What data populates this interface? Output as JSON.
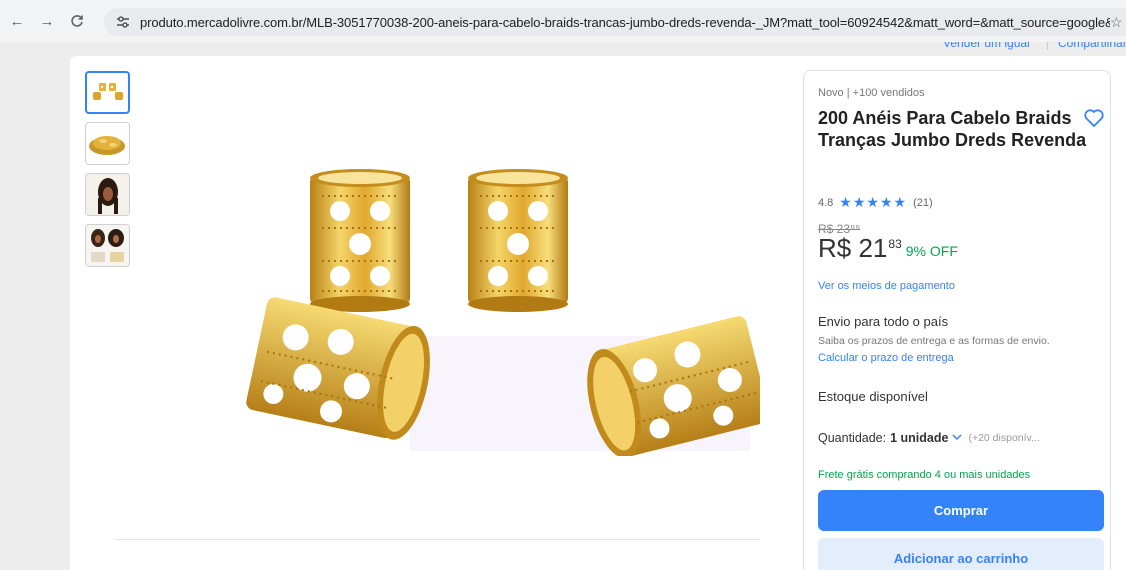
{
  "browser": {
    "url": "produto.mercadolivre.com.br/MLB-3051770038-200-aneis-para-cabelo-braids-trancas-jumbo-dreds-revenda-_JM?matt_tool=60924542&matt_word=&matt_source=google&...",
    "back_icon": "←",
    "forward_icon": "→",
    "reload_icon": "C"
  },
  "header_strip": {
    "left_link": "",
    "right_links": [
      "Vender um igual",
      "Compartilhar"
    ]
  },
  "gallery": {
    "thumbnails": [
      "rings-thumb",
      "pile-thumb",
      "braid-model-thumb",
      "collage-thumb"
    ],
    "active_index": 0
  },
  "product": {
    "condition": "Novo  |  +100 vendidos",
    "title": "200 Anéis Para Cabelo Braids Tranças Jumbo Dreds Revenda",
    "rating": "4.8",
    "stars": "★★★★★",
    "reviews": "(21)",
    "old_price": "R$ 23⁹⁹",
    "price_int": "R$ 21",
    "price_cents": "83",
    "discount": "9% OFF",
    "payment_link": "Ver os meios de pagamento",
    "ship_title": "Envio para todo o país",
    "ship_sub": "Saiba os prazos de entrega e as formas de envio.",
    "ship_link": "Calcular o prazo de entrega",
    "stock": "Estoque disponível",
    "qty_label": "Quantidade:",
    "qty_value": "1 unidade",
    "qty_avail": "(+20 disponív...",
    "free_shipping": "Frete grátis comprando 4 ou mais unidades",
    "buy_button": "Comprar",
    "cart_button": "Adicionar ao carrinho"
  },
  "colors": {
    "accent": "#3483fa",
    "green": "#00a650",
    "gold": "#e2b23a"
  }
}
